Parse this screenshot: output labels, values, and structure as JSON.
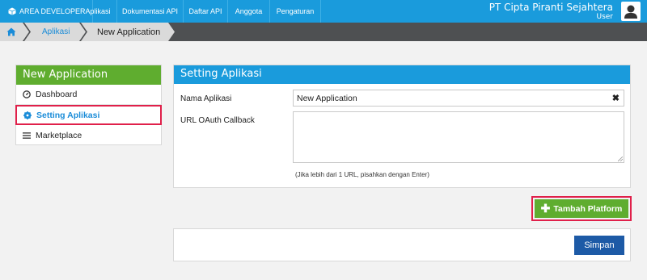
{
  "topnav": {
    "brand_label": "AREA DEVELOPER",
    "items": [
      "Aplikasi",
      "Dokumentasi API",
      "Daftar API",
      "Anggota",
      "Pengaturan"
    ],
    "company_name": "PT Cipta Piranti Sejahtera",
    "user_role": "User",
    "bg_color": "#1a9bdc"
  },
  "breadcrumb": {
    "items": [
      "Aplikasi",
      "New Application"
    ]
  },
  "sidebar": {
    "title": "New Application",
    "items": [
      {
        "label": "Dashboard",
        "icon": "dashboard-icon"
      },
      {
        "label": "Setting Aplikasi",
        "icon": "gear-icon",
        "active": true
      },
      {
        "label": "Marketplace",
        "icon": "list-icon"
      }
    ],
    "header_color": "#5fad2f"
  },
  "settings": {
    "title": "Setting Aplikasi",
    "name_label": "Nama Aplikasi",
    "name_value": "New Application",
    "callback_label": "URL OAuth Callback",
    "callback_value": "",
    "hint": "(Jika lebih dari 1 URL, pisahkan dengan Enter)"
  },
  "actions": {
    "add_platform_label": "Tambah Platform",
    "save_label": "Simpan",
    "highlight_color": "#e0204a",
    "save_color": "#1d5aa6"
  }
}
